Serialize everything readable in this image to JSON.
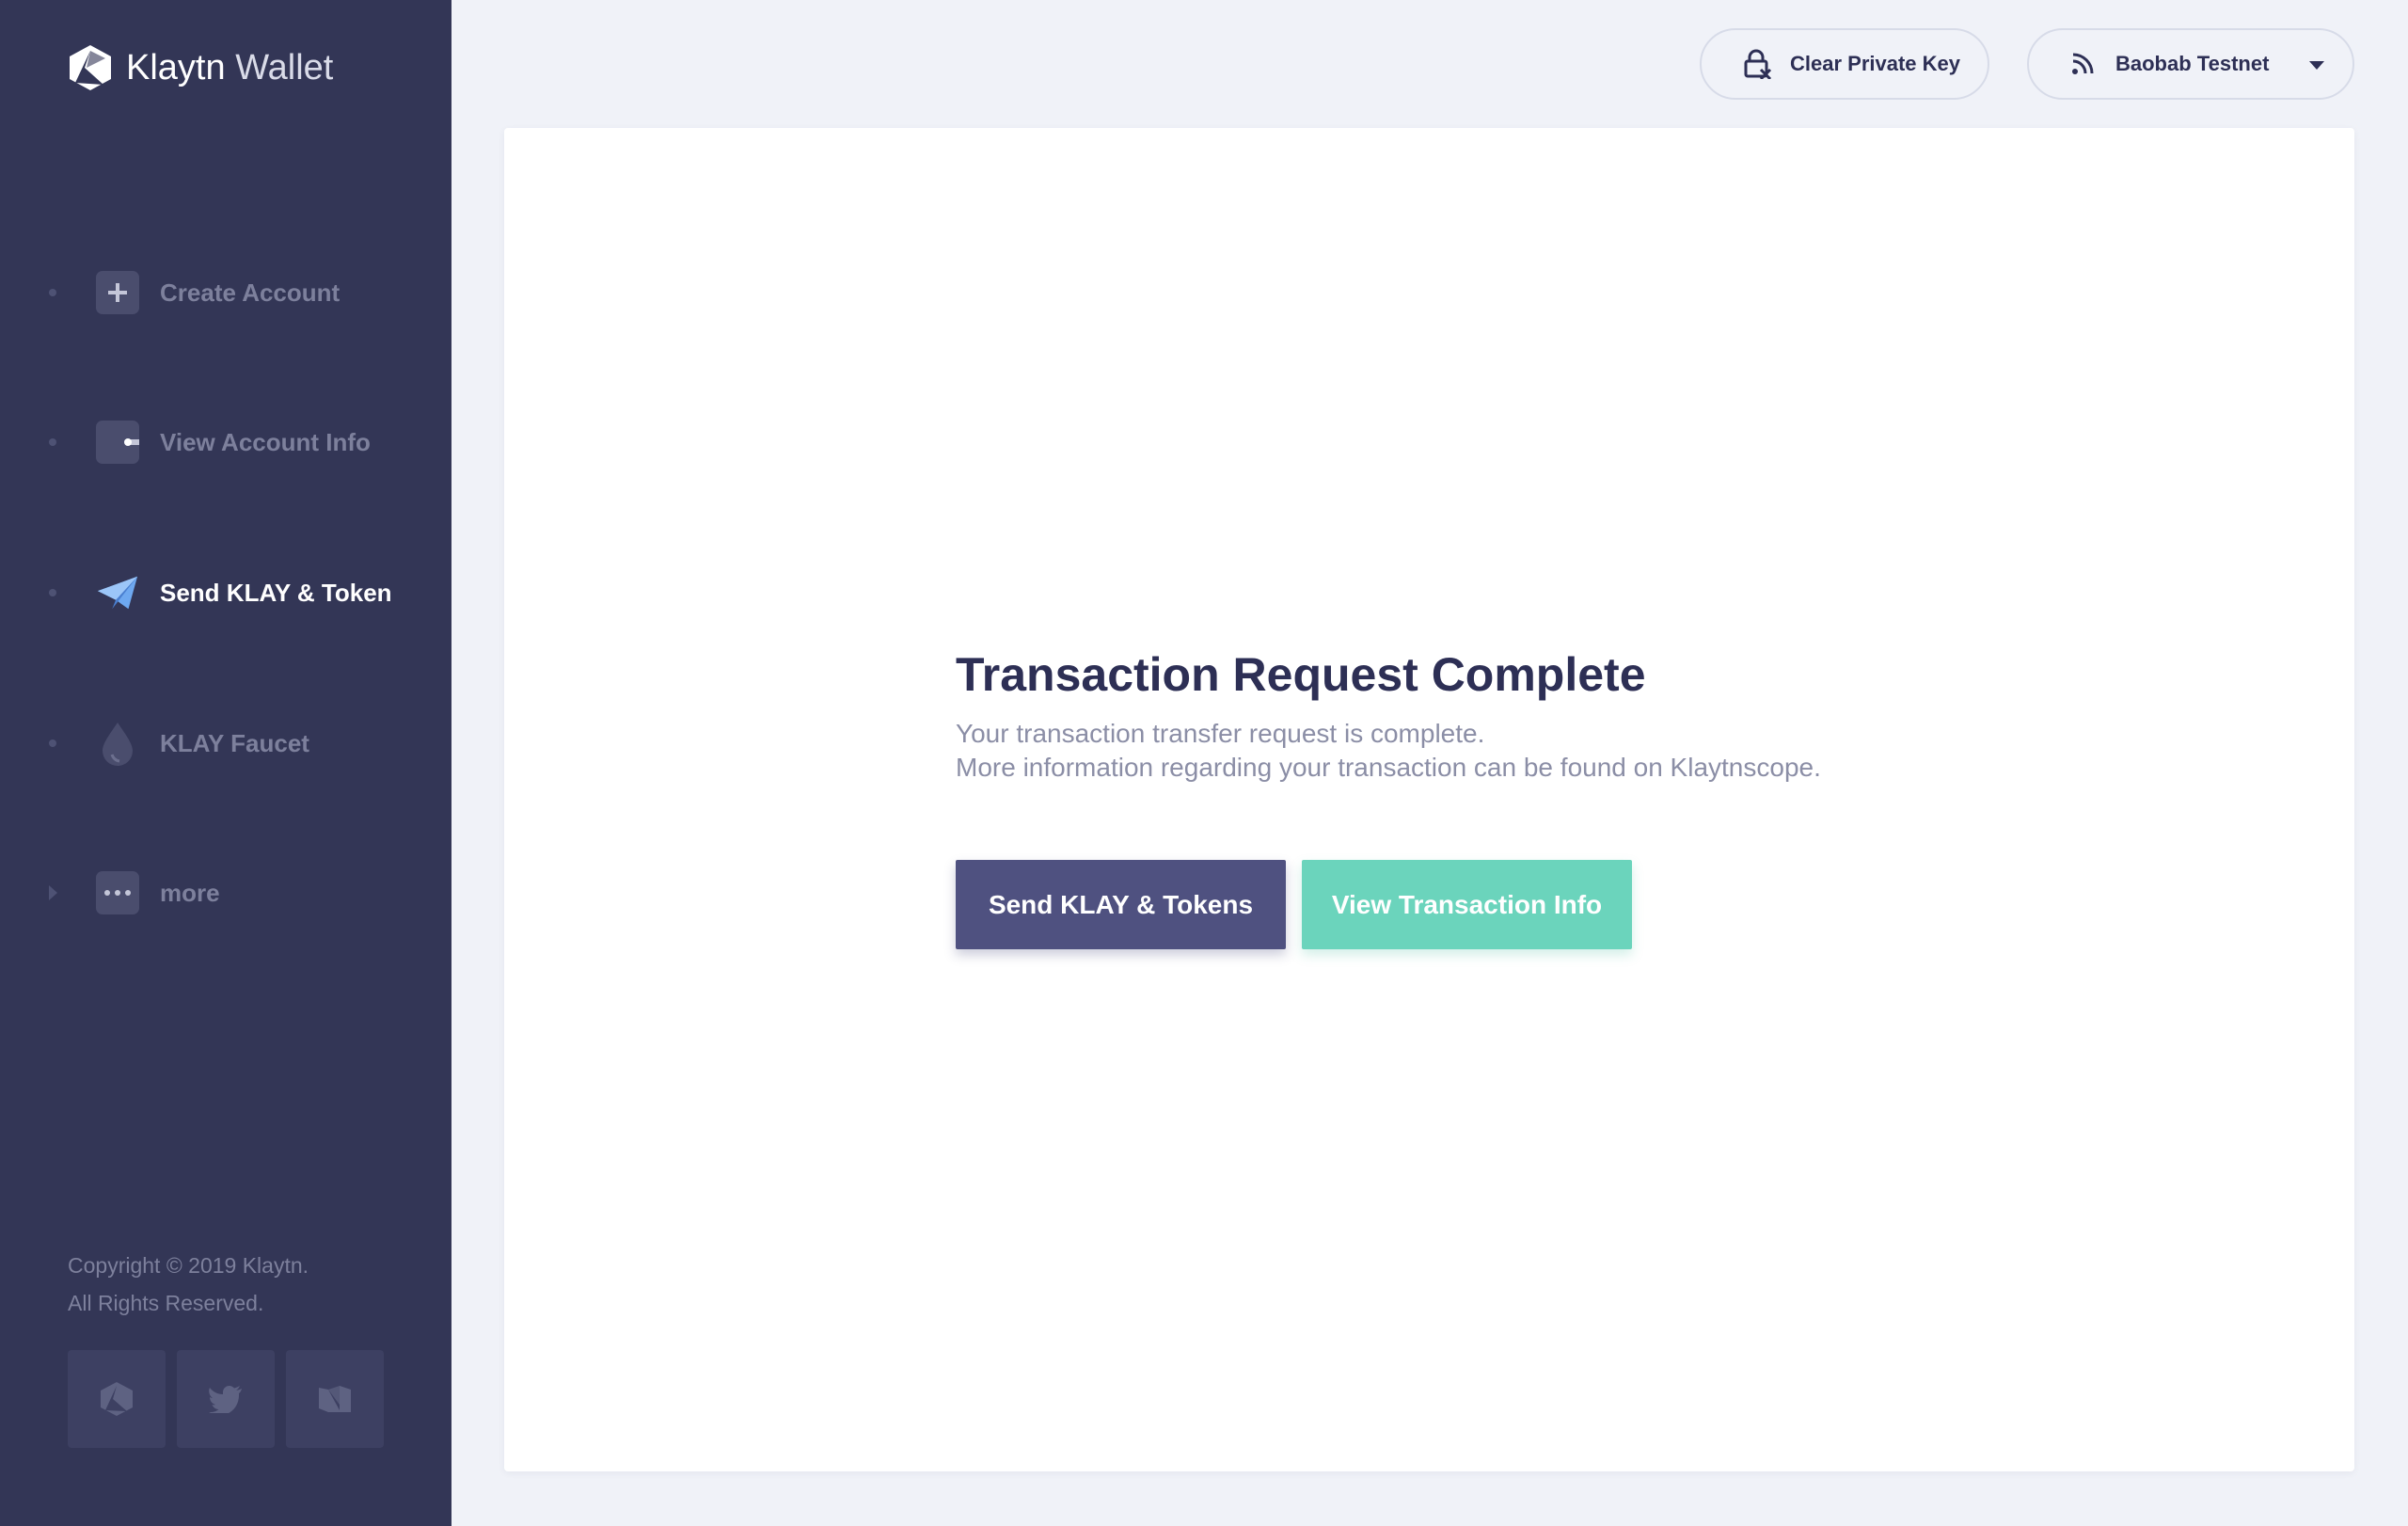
{
  "app": {
    "brand": "Klaytn",
    "product": "Wallet"
  },
  "sidebar": {
    "items": [
      {
        "label": "Create Account",
        "icon": "plus-icon",
        "active": false
      },
      {
        "label": "View Account Info",
        "icon": "wallet-icon",
        "active": false
      },
      {
        "label": "Send KLAY & Token",
        "icon": "paper-plane-icon",
        "active": true
      },
      {
        "label": "KLAY Faucet",
        "icon": "drop-icon",
        "active": false
      },
      {
        "label": "more",
        "icon": "more-dots-icon",
        "active": false,
        "expandable": true
      }
    ],
    "copyright_line1": "Copyright © 2019 Klaytn.",
    "copyright_line2": "All Rights Reserved.",
    "social": [
      "klaytn-icon",
      "twitter-icon",
      "medium-icon"
    ]
  },
  "header": {
    "clear_key_label": "Clear Private Key",
    "network_label": "Baobab Testnet"
  },
  "main": {
    "title": "Transaction Request Complete",
    "description_line1": "Your transaction transfer request is complete.",
    "description_line2": "More information regarding your transaction can be found on Klaytnscope.",
    "send_button_label": "Send KLAY & Tokens",
    "view_button_label": "View Transaction Info"
  },
  "colors": {
    "sidebar_bg": "#333656",
    "page_bg": "#f0f2f8",
    "primary_button": "#4f5180",
    "secondary_button": "#6bd4bc",
    "active_icon": "#6ea8f0"
  }
}
